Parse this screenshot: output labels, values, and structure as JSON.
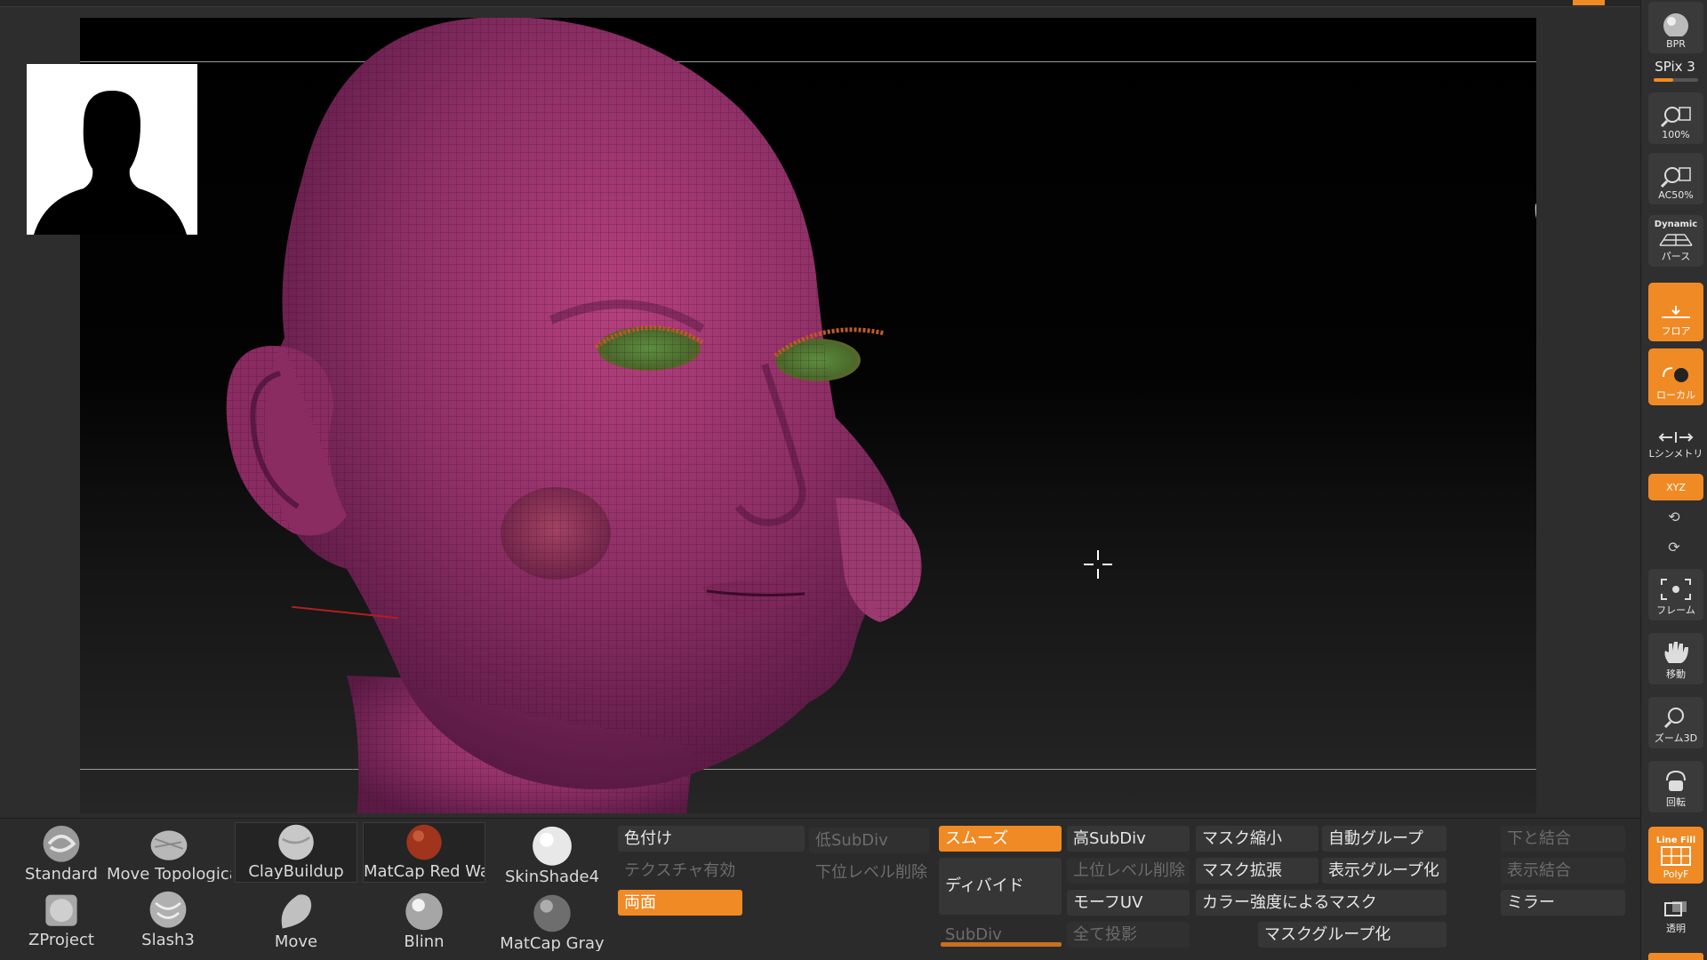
{
  "shelf": {
    "bpr": "BPR",
    "spix": "SPix 3",
    "zoom100": "100%",
    "zoom50": "AC50%",
    "dynamic_top": "Dynamic",
    "dynamic_bottom": "パース",
    "floor": "フロア",
    "local": "ローカル",
    "lsym": "Lシンメトリ",
    "xyz": "XYZ",
    "frame": "フレーム",
    "move": "移動",
    "zoom3d": "ズーム3D",
    "rotate": "回転",
    "polyf_top": "Line Fill",
    "polyf_bottom": "PolyF",
    "transp": "透明"
  },
  "brushes": {
    "standard": "Standard",
    "move_topo": "Move Topologica",
    "claybuildup": "ClayBuildup",
    "matcap_red": "MatCap Red Wa:",
    "skinshade": "SkinShade4",
    "zproject": "ZProject",
    "slash3": "Slash3",
    "move": "Move",
    "blinn": "Blinn",
    "matcap_gray": "MatCap Gray"
  },
  "panel": {
    "colorize": "色付け",
    "texture_on": "テクスチャ有効",
    "double": "両面",
    "lower_subdiv": "低SubDiv",
    "del_lower": "下位レベル削除",
    "smooth": "スムーズ",
    "divide": "ディバイド",
    "subdiv": "SubDiv",
    "higher_subdiv": "高SubDiv",
    "del_higher": "上位レベル削除",
    "morph_uv": "モーフUV",
    "project_all": "全て投影",
    "mask_shrink": "マスク縮小",
    "mask_grow": "マスク拡張",
    "mask_by_intensity": "カラー強度によるマスク",
    "mask_group": "マスクグループ化",
    "auto_group": "自動グループ",
    "visible_group": "表示グループ化",
    "merge_down": "下と結合",
    "merge_visible": "表示結合",
    "mirror": "ミラー"
  },
  "colors": {
    "accent": "#f08a24",
    "mesh": "#8a2a6a"
  }
}
